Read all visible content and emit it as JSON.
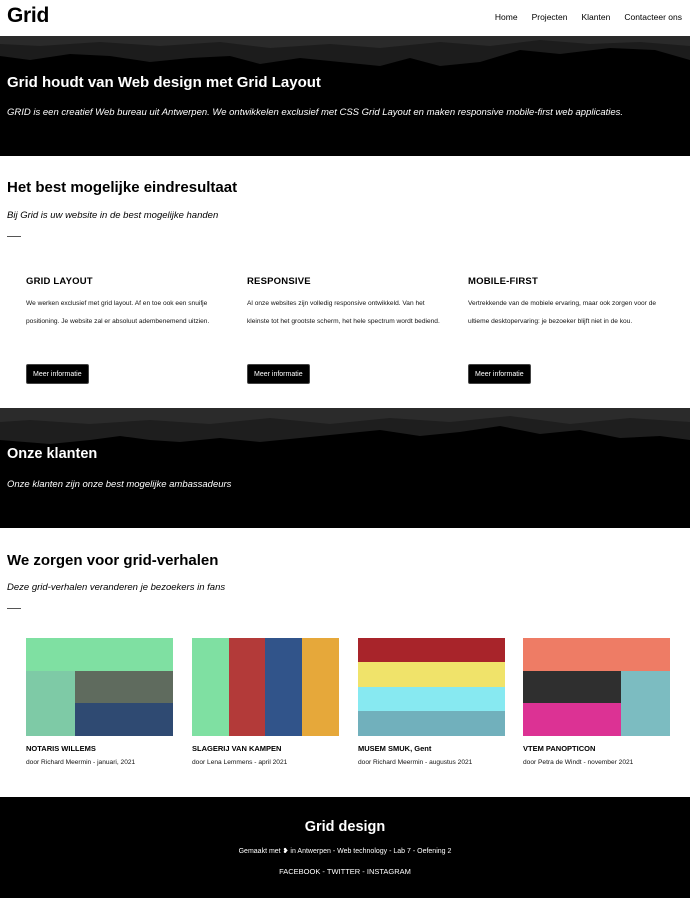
{
  "header": {
    "logo": "Grid",
    "nav": [
      "Home",
      "Projecten",
      "Klanten",
      "Contacteer ons"
    ]
  },
  "hero": {
    "title": "Grid houdt van Web design met Grid Layout",
    "subtitle": "GRID is een creatief Web bureau uit Antwerpen. We ontwikkelen exclusief met CSS Grid Layout en maken responsive mobile-first web applicaties."
  },
  "best": {
    "title": "Het best mogelijke eindresultaat",
    "subtitle": "Bij Grid is uw website in de best mogelijke handen",
    "features": [
      {
        "title": "GRID LAYOUT",
        "text": "We werken exclusief met grid layout. Af en toe ook een snuifje positioning. Je website zal er absoluut adembenemend uitzien.",
        "button": "Meer informatie"
      },
      {
        "title": "RESPONSIVE",
        "text": "Al onze websites zijn volledig responsive ontwikkeld. Van het kleinste tot het grootste scherm, het hele spectrum wordt bediend.",
        "button": "Meer informatie"
      },
      {
        "title": "MOBILE-FIRST",
        "text": "Vertrekkende van de mobiele ervaring, maar ook zorgen voor de ultieme desktopervaring: je bezoeker blijft niet in de kou.",
        "button": "Meer informatie"
      }
    ]
  },
  "clients": {
    "title": "Onze klanten",
    "subtitle": "Onze klanten zijn onze best mogelijke ambassadeurs"
  },
  "stories": {
    "title": "We zorgen voor grid-verhalen",
    "subtitle": "Deze grid-verhalen veranderen je bezoekers in fans",
    "cards": [
      {
        "title": "NOTARIS WILLEMS",
        "meta": "door Richard Meermin - januari, 2021",
        "colors": [
          "#7fe0a2",
          "#7ecaa6",
          "#5f6b5e",
          "#2f4a72"
        ]
      },
      {
        "title": "SLAGERIJ VAN KAMPEN",
        "meta": "door Lena Lemmens - april 2021",
        "colors": [
          "#7fe0a2",
          "#b33a39",
          "#31548a",
          "#e6a83a"
        ]
      },
      {
        "title": "MUSEM SMUK, Gent",
        "meta": "door Richard Meermin - augustus 2021",
        "colors": [
          "#a8242a",
          "#f0e36a",
          "#87e9f1",
          "#71b0bc"
        ]
      },
      {
        "title": "VTEM PANOPTICON",
        "meta": "door Petra de Windt - november 2021",
        "colors": [
          "#ee7c65",
          "#2f2f2f",
          "#7cbcc1",
          "#dc3294"
        ]
      }
    ]
  },
  "footer": {
    "title": "Grid design",
    "made_prefix": "Gemaakt met",
    "heart": "❥",
    "made_suffix": "in Antwerpen - Web technology - Lab 7 - Oefening 2",
    "social": [
      "FACEBOOK",
      "TWITTER",
      "INSTAGRAM"
    ],
    "separator": " - "
  }
}
